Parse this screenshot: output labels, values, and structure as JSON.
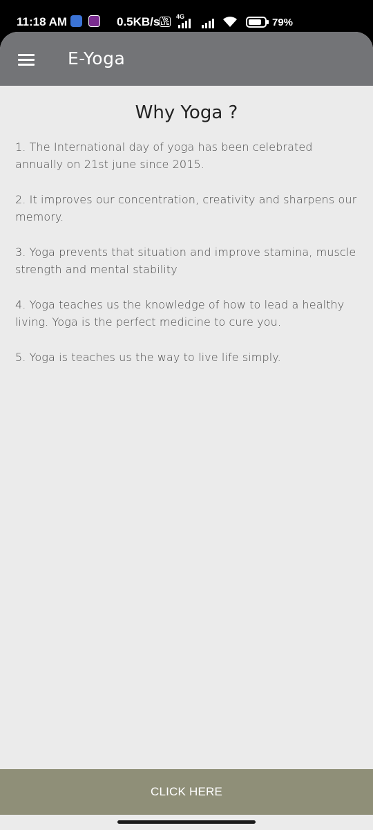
{
  "status_bar": {
    "time": "11:18 AM",
    "net_speed": "0.5KB/s",
    "volte_label": "Vo LTE",
    "network_type": "4G",
    "battery": "79%"
  },
  "toolbar": {
    "menu_icon": "hamburger-menu-icon",
    "title": "E-Yoga"
  },
  "main": {
    "title": "Why Yoga ?",
    "points": [
      "1. The International day of yoga has been celebrated annually on 21st june since 2015.",
      "2. It improves our concentration, creativity and sharpens our memory.",
      "3. Yoga prevents that situation and improve stamina, muscle strength and mental stability",
      "4. Yoga teaches us the knowledge of how to lead a healthy living. Yoga is the perfect medicine to cure you.",
      "5. Yoga is teaches us the way to live life simply."
    ]
  },
  "cta": {
    "label": "CLICK HERE"
  },
  "colors": {
    "toolbar": "#737477",
    "background": "#ebebeb",
    "cta": "#8f8f78"
  }
}
